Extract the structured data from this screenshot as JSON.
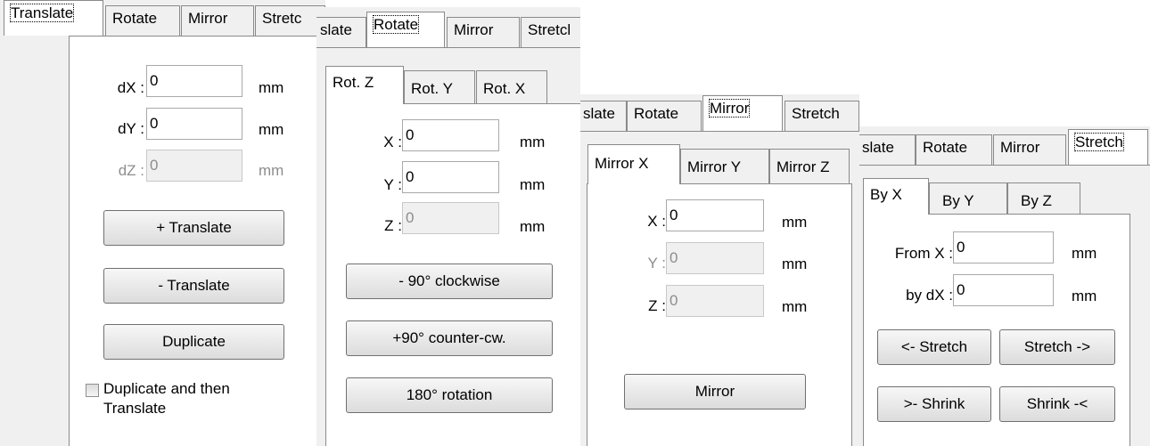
{
  "main_tabs": [
    "Translate",
    "Rotate",
    "Mirror",
    "Stretch"
  ],
  "main_tabs_clipped": {
    "stretch_p1": "Stretc",
    "translate_p2": "slate",
    "stretch_p2": "Stretcl",
    "translate_p3": "slate",
    "translate_p4": "slate"
  },
  "units": "mm",
  "translate": {
    "fields": [
      {
        "label": "dX :",
        "value": "0"
      },
      {
        "label": "dY :",
        "value": "0"
      },
      {
        "label": "dZ :",
        "value": "0"
      }
    ],
    "buttons": [
      "+ Translate",
      "- Translate",
      "Duplicate"
    ],
    "checkbox_label": "Duplicate and then Translate"
  },
  "rotate": {
    "subtabs": [
      "Rot. Z",
      "Rot. Y",
      "Rot. X"
    ],
    "fields": [
      {
        "label": "X :",
        "value": "0"
      },
      {
        "label": "Y :",
        "value": "0"
      },
      {
        "label": "Z :",
        "value": "0"
      }
    ],
    "buttons": [
      "- 90° clockwise",
      "+90° counter-cw.",
      "180° rotation"
    ]
  },
  "mirror": {
    "subtabs": [
      "Mirror X",
      "Mirror Y",
      "Mirror Z"
    ],
    "fields": [
      {
        "label": "X :",
        "value": "0"
      },
      {
        "label": "Y :",
        "value": "0"
      },
      {
        "label": "Z :",
        "value": "0"
      }
    ],
    "button": "Mirror"
  },
  "stretch": {
    "subtabs": [
      "By X",
      "By Y",
      "By Z"
    ],
    "fields": [
      {
        "label": "From X :",
        "value": "0"
      },
      {
        "label": "by dX :",
        "value": "0"
      }
    ],
    "buttons": [
      "<- Stretch",
      "Stretch ->",
      ">- Shrink",
      "Shrink -<"
    ]
  }
}
